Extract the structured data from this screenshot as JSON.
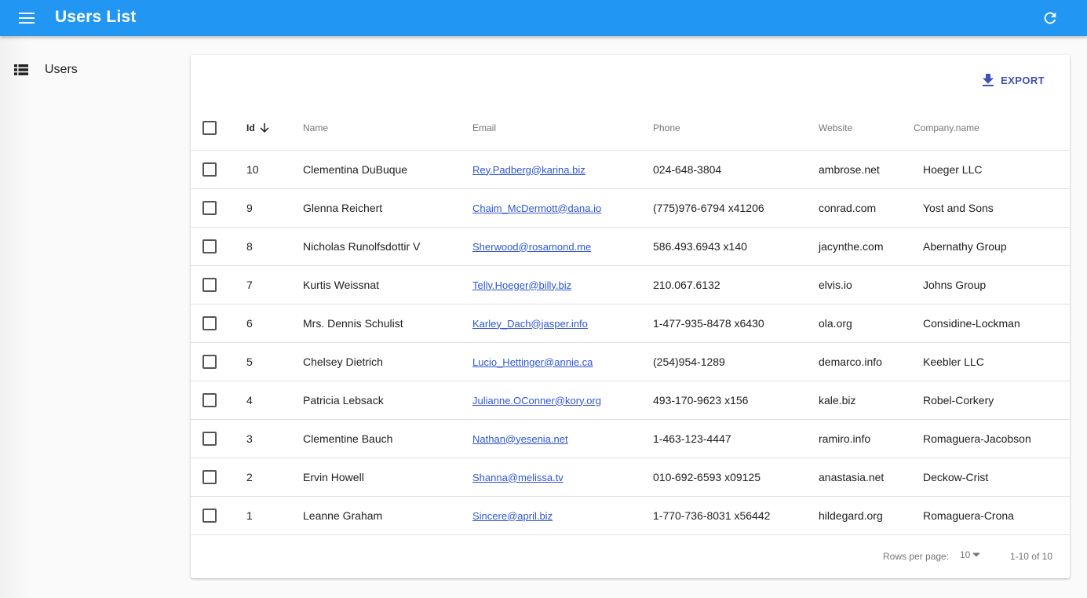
{
  "app": {
    "title": "Users List",
    "menu_icon": "menu-icon",
    "refresh_icon": "refresh-icon",
    "accent_color": "#2196f3"
  },
  "sidebar": {
    "items": [
      {
        "label": "Users",
        "icon": "list-icon"
      }
    ]
  },
  "toolbar": {
    "export_label": "EXPORT",
    "export_icon": "download-icon",
    "export_color": "#3f51b5"
  },
  "table": {
    "columns": {
      "id": "Id",
      "name": "Name",
      "email": "Email",
      "phone": "Phone",
      "website": "Website",
      "company": "Company.name"
    },
    "sort_icon": "arrow-down-icon",
    "rows": [
      {
        "id": "10",
        "name": "Clementina DuBuque",
        "email": "Rey.Padberg@karina.biz",
        "phone": "024-648-3804",
        "website": "ambrose.net",
        "company": "Hoeger LLC"
      },
      {
        "id": "9",
        "name": "Glenna Reichert",
        "email": "Chaim_McDermott@dana.io",
        "phone": "(775)976-6794 x41206",
        "website": "conrad.com",
        "company": "Yost and Sons"
      },
      {
        "id": "8",
        "name": "Nicholas Runolfsdottir V",
        "email": "Sherwood@rosamond.me",
        "phone": "586.493.6943 x140",
        "website": "jacynthe.com",
        "company": "Abernathy Group"
      },
      {
        "id": "7",
        "name": "Kurtis Weissnat",
        "email": "Telly.Hoeger@billy.biz",
        "phone": "210.067.6132",
        "website": "elvis.io",
        "company": "Johns Group"
      },
      {
        "id": "6",
        "name": "Mrs. Dennis Schulist",
        "email": "Karley_Dach@jasper.info",
        "phone": "1-477-935-8478 x6430",
        "website": "ola.org",
        "company": "Considine-Lockman"
      },
      {
        "id": "5",
        "name": "Chelsey Dietrich",
        "email": "Lucio_Hettinger@annie.ca",
        "phone": "(254)954-1289",
        "website": "demarco.info",
        "company": "Keebler LLC"
      },
      {
        "id": "4",
        "name": "Patricia Lebsack",
        "email": "Julianne.OConner@kory.org",
        "phone": "493-170-9623 x156",
        "website": "kale.biz",
        "company": "Robel-Corkery"
      },
      {
        "id": "3",
        "name": "Clementine Bauch",
        "email": "Nathan@yesenia.net",
        "phone": "1-463-123-4447",
        "website": "ramiro.info",
        "company": "Romaguera-Jacobson"
      },
      {
        "id": "2",
        "name": "Ervin Howell",
        "email": "Shanna@melissa.tv",
        "phone": "010-692-6593 x09125",
        "website": "anastasia.net",
        "company": "Deckow-Crist"
      },
      {
        "id": "1",
        "name": "Leanne Graham",
        "email": "Sincere@april.biz",
        "phone": "1-770-736-8031 x56442",
        "website": "hildegard.org",
        "company": "Romaguera-Crona"
      }
    ]
  },
  "pagination": {
    "rows_per_page_label": "Rows per page:",
    "rows_per_page_value": "10",
    "range": "1-10 of 10"
  }
}
